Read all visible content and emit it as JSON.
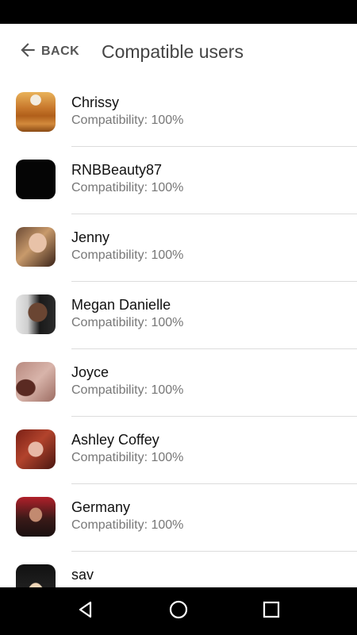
{
  "header": {
    "back_label": "BACK",
    "title": "Compatible users"
  },
  "users": [
    {
      "name": "Chrissy",
      "compatibility": "Compatibility: 100%"
    },
    {
      "name": "RNBBeauty87",
      "compatibility": "Compatibility: 100%"
    },
    {
      "name": "Jenny",
      "compatibility": "Compatibility: 100%"
    },
    {
      "name": "Megan Danielle",
      "compatibility": "Compatibility: 100%"
    },
    {
      "name": "Joyce",
      "compatibility": "Compatibility: 100%"
    },
    {
      "name": "Ashley Coffey",
      "compatibility": "Compatibility: 100%"
    },
    {
      "name": "Germany",
      "compatibility": "Compatibility: 100%"
    },
    {
      "name": "sav",
      "compatibility": ""
    }
  ],
  "nav": {
    "back_icon": "triangle-back-icon",
    "home_icon": "circle-home-icon",
    "recents_icon": "square-recents-icon"
  },
  "colors": {
    "title": "#444444",
    "name": "#111111",
    "subtitle": "#777777",
    "divider": "#dcdcdc",
    "system_bars": "#000000"
  }
}
